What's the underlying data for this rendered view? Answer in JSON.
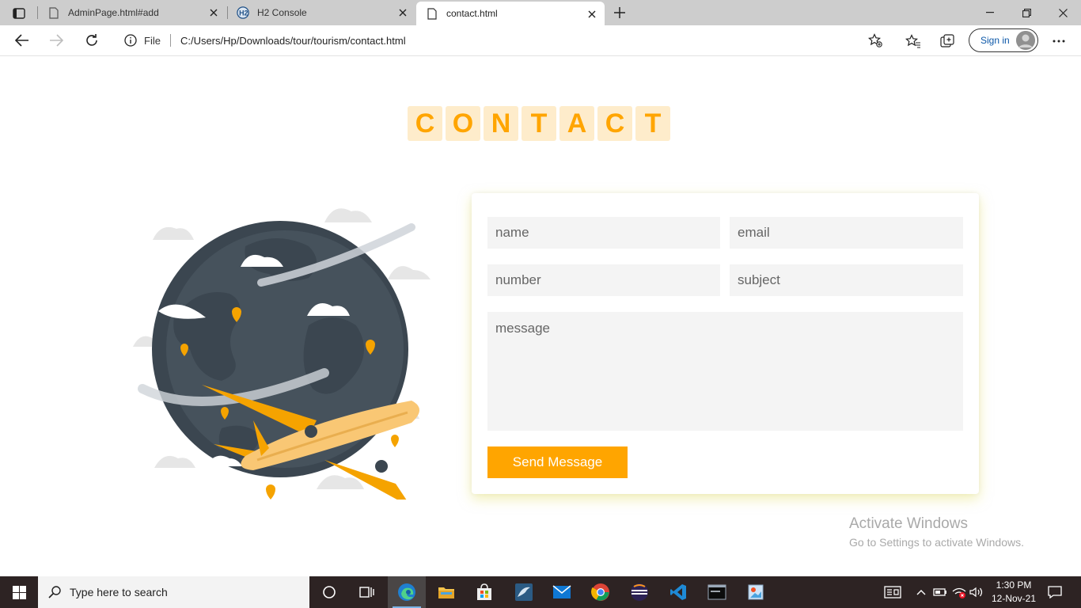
{
  "browser": {
    "tabs": [
      {
        "title": "AdminPage.html#add",
        "active": false
      },
      {
        "title": "H2 Console",
        "active": false
      },
      {
        "title": "contact.html",
        "active": true
      }
    ],
    "address": {
      "scheme_label": "File",
      "url": "C:/Users/Hp/Downloads/tour/tourism/contact.html"
    },
    "sign_in_label": "Sign in"
  },
  "page": {
    "heading_letters": [
      "C",
      "O",
      "N",
      "T",
      "A",
      "C",
      "T"
    ],
    "form": {
      "name_placeholder": "name",
      "email_placeholder": "email",
      "number_placeholder": "number",
      "subject_placeholder": "subject",
      "message_placeholder": "message",
      "send_label": "Send Message"
    },
    "colors": {
      "accent": "#ffa500",
      "letter_bg": "#feeccb",
      "field_bg": "#f4f4f4",
      "globe": "#3b4650",
      "plane": "#f9c774"
    }
  },
  "watermark": {
    "title": "Activate Windows",
    "subtitle": "Go to Settings to activate Windows."
  },
  "taskbar": {
    "search_placeholder": "Type here to search",
    "apps": [
      "cortana-icon",
      "task-view-icon",
      "edge-icon",
      "file-explorer-icon",
      "store-icon",
      "mysql-workbench-icon",
      "mail-icon",
      "chrome-icon",
      "eclipse-icon",
      "vscode-icon",
      "mysql-cli-icon",
      "paint-icon"
    ],
    "time": "1:30 PM",
    "date": "12-Nov-21"
  }
}
